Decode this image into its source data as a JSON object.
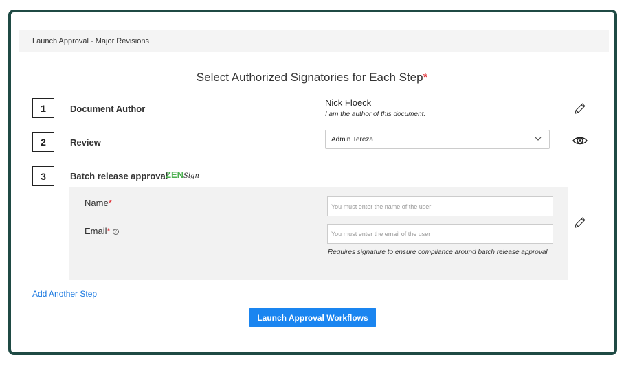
{
  "breadcrumb": "Launch Approval - Major Revisions",
  "heading": "Select Authorized Signatories for Each Step",
  "required_mark": "*",
  "steps": [
    {
      "number": "1",
      "label": "Document Author",
      "author_name": "Nick Floeck",
      "author_note": "I am the author of this document.",
      "action_icon": "pencil-icon"
    },
    {
      "number": "2",
      "label": "Review",
      "selected_user": "Admin Tereza",
      "action_icon": "eye-icon"
    },
    {
      "number": "3",
      "label": "Batch release approval",
      "badge_zen": "ZEN",
      "badge_sign": "Sign",
      "action_icon": "pencil-icon"
    }
  ],
  "form": {
    "name_label": "Name",
    "name_placeholder": "You must enter the name of the user",
    "email_label": "Email",
    "help_icon": "?",
    "email_placeholder": "You must enter the email of the user",
    "note": "Requires signature to ensure compliance around batch release approval"
  },
  "add_step_label": "Add Another Step",
  "launch_button_label": "Launch Approval Workflows",
  "colors": {
    "frame": "#1f4a44",
    "accent": "#1a85f0",
    "link": "#1877e0",
    "required": "#e0282e",
    "zen": "#4caf50"
  }
}
